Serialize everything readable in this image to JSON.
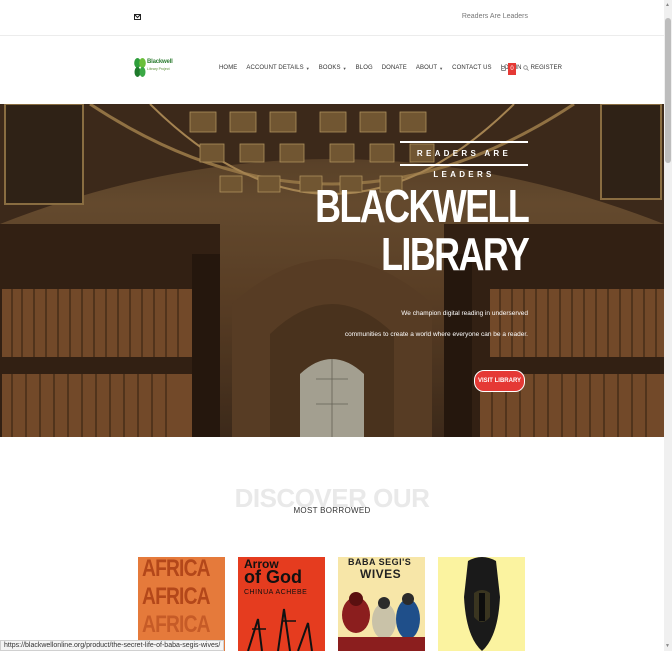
{
  "topbar": {
    "tagline": "Readers Are Leaders",
    "icon": "mail-icon"
  },
  "logo": {
    "name": "Blackwell",
    "sub": "Library Project"
  },
  "nav": [
    {
      "label": "HOME",
      "dropdown": false
    },
    {
      "label": "ACCOUNT DETAILS",
      "dropdown": true
    },
    {
      "label": "BOOKS",
      "dropdown": true
    },
    {
      "label": "BLOG",
      "dropdown": false
    },
    {
      "label": "DONATE",
      "dropdown": false
    },
    {
      "label": "ABOUT",
      "dropdown": true
    },
    {
      "label": "CONTACT US",
      "dropdown": false
    },
    {
      "label": "LOG IN",
      "dropdown": false
    },
    {
      "label": "REGISTER",
      "dropdown": false
    }
  ],
  "cart": {
    "count": "0"
  },
  "hero": {
    "kicker": "READERS ARE LEADERS",
    "title_line1": "BLACKWELL",
    "title_line2": "LIBRARY",
    "desc_line1": "We champion digital reading in underserved",
    "desc_line2": "communities to create a world where everyone can be a reader.",
    "cta": "VISIT LIBRARY"
  },
  "discover": {
    "ghost": "DISCOVER OUR",
    "subtitle": "MOST BORROWED"
  },
  "books": [
    {
      "title": "AFRICA"
    },
    {
      "title_top": "Arrow",
      "title_main": "of God",
      "author": "CHINUA ACHEBE"
    },
    {
      "title_top": "BABA SEGI'S",
      "title_main": "WIVES"
    },
    {
      "title": ""
    }
  ],
  "status_url": "https://blackwellonline.org/product/the-secret-life-of-baba-segis-wives/",
  "colors": {
    "accent": "#e53935",
    "brand_green": "#2e7d32"
  }
}
